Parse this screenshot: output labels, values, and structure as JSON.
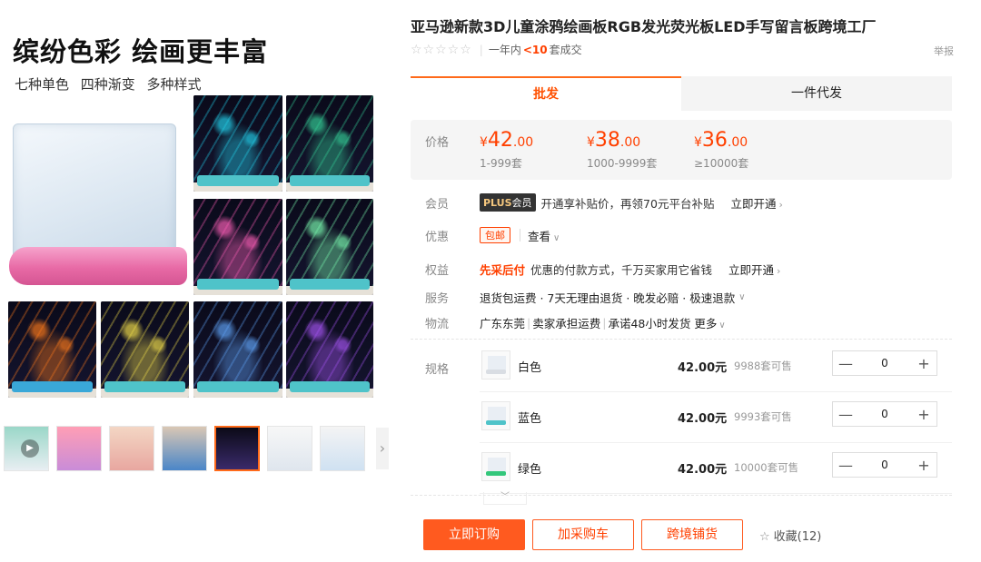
{
  "gallery": {
    "headline": "缤纷色彩 绘画更丰富",
    "subline": "七种单色  四种渐变  多种样式",
    "colors": {
      "pink_base": "#e86aa6",
      "teal_base": "#4fc3c9",
      "neon_cyan": "#22d3ee",
      "neon_green": "#34d399",
      "neon_pink": "#ff5fb8",
      "neon_orange": "#ff7a1a",
      "neon_purple": "#a855f7"
    },
    "thumbs": [
      {
        "glow": "#22d3ee"
      },
      {
        "glow": "#34d399"
      },
      {
        "glow": "#ff5fb8"
      },
      {
        "glow": "#7cffb2"
      },
      {
        "glow": "#ff7a1a"
      },
      {
        "glow": "#f5e14a"
      },
      {
        "glow": "#60a5fa"
      },
      {
        "glow": "#a855f7"
      }
    ],
    "filmstrip_count": 8
  },
  "product": {
    "title": "亚马逊新款3D儿童涂鸦绘画板RGB发光荧光板LED手写留言板跨境工厂",
    "rating_text_prefix": "一年内",
    "rating_count": "<10",
    "rating_text_suffix": "套成交",
    "report": "举报"
  },
  "tabs": [
    {
      "label": "批发",
      "active": true
    },
    {
      "label": "一件代发",
      "active": false
    }
  ],
  "price": {
    "label": "价格",
    "tiers": [
      {
        "symbol": "¥",
        "int": "42",
        "dec": ".00",
        "range": "1-999套"
      },
      {
        "symbol": "¥",
        "int": "38",
        "dec": ".00",
        "range": "1000-9999套"
      },
      {
        "symbol": "¥",
        "int": "36",
        "dec": ".00",
        "range": "≥10000套"
      }
    ]
  },
  "member": {
    "label": "会员",
    "badge_plus": "PLUS",
    "badge_text": "会员",
    "text": "开通享补贴价，再领70元平台补贴",
    "link": "立即开通"
  },
  "discount": {
    "label": "优惠",
    "coupon": "包邮",
    "link": "查看"
  },
  "benefit": {
    "label": "权益",
    "highlight": "先采后付",
    "text": "优惠的付款方式，千万买家用它省钱",
    "link": "立即开通"
  },
  "service": {
    "label": "服务",
    "text": "退货包运费 · 7天无理由退货 · 晚发必赔 · 极速退款"
  },
  "logistics": {
    "label": "物流",
    "origin": "广东东莞",
    "freight": "卖家承担运费",
    "promise": "承诺48小时发货",
    "more": "更多"
  },
  "specs": {
    "label": "规格",
    "items": [
      {
        "name": "白色",
        "price": "42.00元",
        "stock": "9988套可售",
        "qty": "0",
        "bar": "#d9dde3"
      },
      {
        "name": "蓝色",
        "price": "42.00元",
        "stock": "9993套可售",
        "qty": "0",
        "bar": "#4fc3c9"
      },
      {
        "name": "绿色",
        "price": "42.00元",
        "stock": "10000套可售",
        "qty": "0",
        "bar": "#34c77b"
      }
    ],
    "minus": "—",
    "plus": "+"
  },
  "actions": {
    "order": "立即订购",
    "cart": "加采购车",
    "crossborder": "跨境铺货",
    "favorite": "收藏(12)"
  }
}
